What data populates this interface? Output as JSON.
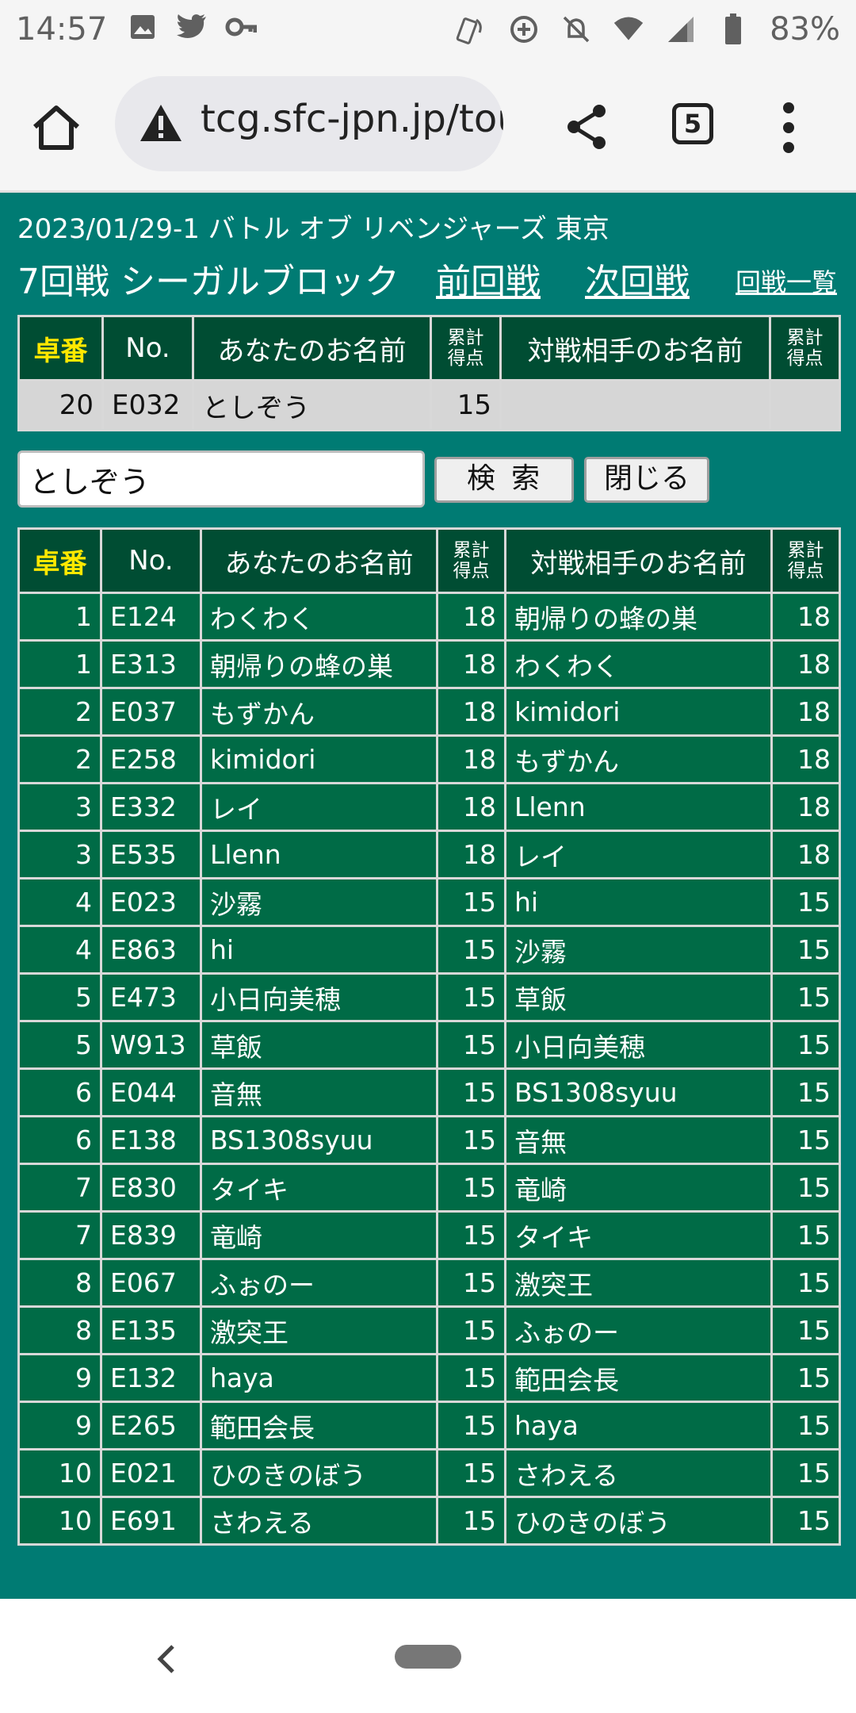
{
  "status_bar": {
    "time": "14:57",
    "battery": "83%",
    "left_icons": [
      "image-icon",
      "twitter-icon",
      "vpn-key-icon"
    ],
    "right_icons": [
      "nfc-icon",
      "data-saver-icon",
      "mute-icon",
      "wifi-icon",
      "signal-icon",
      "battery-icon"
    ]
  },
  "browser": {
    "url": "tcg.sfc-jpn.jp/tou",
    "tab_count": "5"
  },
  "header": {
    "event_title": "2023/01/29-1 バトル オブ リベンジャーズ 東京",
    "round_title": "7回戦 シーガルブロック",
    "prev_link": "前回戦",
    "next_link": "次回戦",
    "list_link": "回戦一覧"
  },
  "columns": {
    "seat": "卓番",
    "no": "No.",
    "your_name": "あなたのお名前",
    "score_line1": "累計",
    "score_line2": "得点",
    "opponent_name": "対戦相手のお名前"
  },
  "my_row": {
    "seat": "20",
    "no": "E032",
    "name": "としぞう",
    "score": "15",
    "opp_name": "",
    "opp_score": ""
  },
  "search": {
    "value": "としぞう",
    "search_label": "検索",
    "close_label": "閉じる"
  },
  "rows": [
    {
      "seat": "1",
      "no": "E124",
      "name": "わくわく",
      "score": "18",
      "opp": "朝帰りの蜂の巣",
      "opp_score": "18"
    },
    {
      "seat": "1",
      "no": "E313",
      "name": "朝帰りの蜂の巣",
      "score": "18",
      "opp": "わくわく",
      "opp_score": "18"
    },
    {
      "seat": "2",
      "no": "E037",
      "name": "もずかん",
      "score": "18",
      "opp": "kimidori",
      "opp_score": "18"
    },
    {
      "seat": "2",
      "no": "E258",
      "name": "kimidori",
      "score": "18",
      "opp": "もずかん",
      "opp_score": "18"
    },
    {
      "seat": "3",
      "no": "E332",
      "name": "レイ",
      "score": "18",
      "opp": "Llenn",
      "opp_score": "18"
    },
    {
      "seat": "3",
      "no": "E535",
      "name": "Llenn",
      "score": "18",
      "opp": "レイ",
      "opp_score": "18"
    },
    {
      "seat": "4",
      "no": "E023",
      "name": "沙霧",
      "score": "15",
      "opp": "hi",
      "opp_score": "15"
    },
    {
      "seat": "4",
      "no": "E863",
      "name": "hi",
      "score": "15",
      "opp": "沙霧",
      "opp_score": "15"
    },
    {
      "seat": "5",
      "no": "E473",
      "name": "小日向美穂",
      "score": "15",
      "opp": "草飯",
      "opp_score": "15"
    },
    {
      "seat": "5",
      "no": "W913",
      "name": "草飯",
      "score": "15",
      "opp": "小日向美穂",
      "opp_score": "15"
    },
    {
      "seat": "6",
      "no": "E044",
      "name": "音無",
      "score": "15",
      "opp": "BS1308syuu",
      "opp_score": "15"
    },
    {
      "seat": "6",
      "no": "E138",
      "name": "BS1308syuu",
      "score": "15",
      "opp": "音無",
      "opp_score": "15"
    },
    {
      "seat": "7",
      "no": "E830",
      "name": "タイキ",
      "score": "15",
      "opp": "竜崎",
      "opp_score": "15"
    },
    {
      "seat": "7",
      "no": "E839",
      "name": "竜崎",
      "score": "15",
      "opp": "タイキ",
      "opp_score": "15"
    },
    {
      "seat": "8",
      "no": "E067",
      "name": "ふぉのー",
      "score": "15",
      "opp": "激突王",
      "opp_score": "15"
    },
    {
      "seat": "8",
      "no": "E135",
      "name": "激突王",
      "score": "15",
      "opp": "ふぉのー",
      "opp_score": "15"
    },
    {
      "seat": "9",
      "no": "E132",
      "name": "haya",
      "score": "15",
      "opp": "範田会長",
      "opp_score": "15"
    },
    {
      "seat": "9",
      "no": "E265",
      "name": "範田会長",
      "score": "15",
      "opp": "haya",
      "opp_score": "15"
    },
    {
      "seat": "10",
      "no": "E021",
      "name": "ひのきのぼう",
      "score": "15",
      "opp": "さわえる",
      "opp_score": "15"
    },
    {
      "seat": "10",
      "no": "E691",
      "name": "さわえる",
      "score": "15",
      "opp": "ひのきのぼう",
      "opp_score": "15"
    }
  ],
  "colors": {
    "page_bg": "#007b73",
    "header_bg": "#004d33",
    "row_bg": "#006b46",
    "seat_header": "#ffe800"
  }
}
